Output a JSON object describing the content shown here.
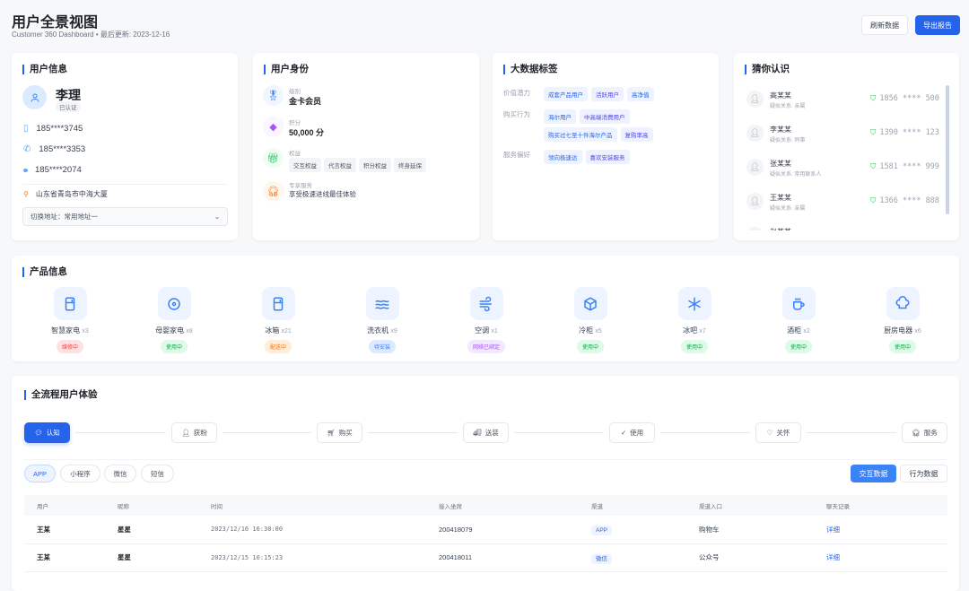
{
  "header": {
    "title": "用户全景视图",
    "subtitle": "Customer 360 Dashboard • 最后更新: 2023-12-16",
    "refresh": "刷新数据",
    "export": "导出报告"
  },
  "user_info": {
    "title": "用户信息",
    "name": "李理",
    "verified": "已认证",
    "mobile": "185****3745",
    "phone": "185****3353",
    "other": "185****2074",
    "address": "山东省青岛市中海大厦",
    "address_select": "切换地址：常用地址一"
  },
  "identity": {
    "title": "用户身份",
    "level_label": "级别",
    "level": "金卡会员",
    "points_label": "积分",
    "points": "50,000 分",
    "rights_label": "权益",
    "rights": [
      "交互权益",
      "代言权益",
      "积分权益",
      "终身延保"
    ],
    "service_label": "专享服务",
    "service": "享受极速进线最佳体验"
  },
  "tags": {
    "title": "大数据标签",
    "groups": [
      {
        "label": "价值潜力",
        "tags": [
          "成套产品用户",
          "活跃用户",
          "高净值"
        ]
      },
      {
        "label": "购买行为",
        "tags": [
          "海尔用户",
          "中高端消费用户",
          "购买过七至十件海尔产品",
          "复购率高"
        ]
      },
      {
        "label": "服务偏好",
        "tags": [
          "领向极速达",
          "喜欢安装服务"
        ]
      }
    ]
  },
  "guess": {
    "title": "猜你认识",
    "people": [
      {
        "name": "高某某",
        "rel": "疑似关系: 亲属",
        "phone": "1856 **** 500"
      },
      {
        "name": "李某某",
        "rel": "疑似关系: 同事",
        "phone": "1390 **** 123"
      },
      {
        "name": "张某某",
        "rel": "疑似关系: 常用联系人",
        "phone": "1581 **** 999"
      },
      {
        "name": "王某某",
        "rel": "疑似关系: 亲属",
        "phone": "1366 **** 888"
      },
      {
        "name": "赵某某",
        "rel": "",
        "phone": ""
      }
    ]
  },
  "products": {
    "title": "产品信息",
    "items": [
      {
        "name": "智慧家电",
        "count": "x3",
        "status": "维修中",
        "icon": "fridge-icon",
        "color": "red"
      },
      {
        "name": "母婴家电",
        "count": "x8",
        "status": "使用中",
        "icon": "disc-icon",
        "color": "green"
      },
      {
        "name": "冰箱",
        "count": "x21",
        "status": "配送中",
        "icon": "fridge-icon",
        "color": "orange"
      },
      {
        "name": "洗衣机",
        "count": "x9",
        "status": "待安装",
        "icon": "waves-icon",
        "color": "blue"
      },
      {
        "name": "空调",
        "count": "x1",
        "status": "网络已绑定",
        "icon": "wind-icon",
        "color": "purple"
      },
      {
        "name": "冷柜",
        "count": "x5",
        "status": "使用中",
        "icon": "box-icon",
        "color": "green"
      },
      {
        "name": "冰吧",
        "count": "x7",
        "status": "使用中",
        "icon": "snowflake-icon",
        "color": "green"
      },
      {
        "name": "酒柜",
        "count": "x2",
        "status": "使用中",
        "icon": "cup-icon",
        "color": "green"
      },
      {
        "name": "厨房电器",
        "count": "x6",
        "status": "使用中",
        "icon": "chef-hat-icon",
        "color": "green"
      }
    ]
  },
  "journey": {
    "title": "全流程用户体验",
    "steps": [
      "认知",
      "获粉",
      "购买",
      "送装",
      "使用",
      "关怀",
      "服务"
    ],
    "channels": [
      "APP",
      "小程序",
      "微信",
      "短信"
    ],
    "data_tabs": [
      "交互数据",
      "行为数据"
    ],
    "columns": [
      "用户",
      "昵称",
      "时间",
      "接入坐席",
      "渠道",
      "渠道入口",
      "聊天记录"
    ],
    "rows": [
      [
        "王某",
        "星星",
        "2023/12/16 16:30:00",
        "200418079",
        "APP",
        "购物车",
        "详细"
      ],
      [
        "王某",
        "星星",
        "2023/12/15 10:15:23",
        "200418011",
        "微信",
        "公众号",
        "详细"
      ]
    ]
  }
}
